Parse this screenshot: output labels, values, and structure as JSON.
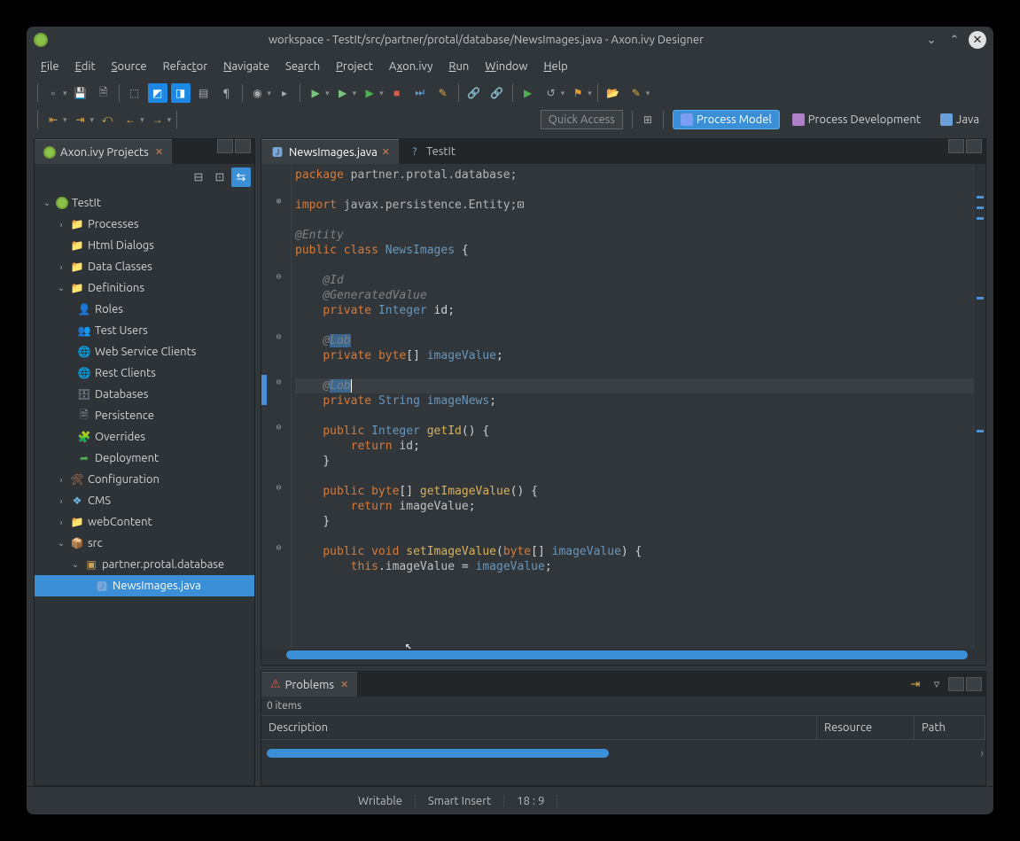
{
  "titlebar": {
    "title": "workspace - TestIt/src/partner/protal/database/NewsImages.java - Axon.ivy Designer"
  },
  "menu": [
    "File",
    "Edit",
    "Source",
    "Refactor",
    "Navigate",
    "Search",
    "Project",
    "Axon.ivy",
    "Run",
    "Window",
    "Help"
  ],
  "quick_access": "Quick Access",
  "perspectives": {
    "process_model": "Process Model",
    "process_dev": "Process Development",
    "java": "Java"
  },
  "left_view": {
    "title": "Axon.ivy Projects"
  },
  "tree": {
    "root": "TestIt",
    "items": [
      "Processes",
      "Html Dialogs",
      "Data Classes",
      "Definitions",
      "Roles",
      "Test Users",
      "Web Service Clients",
      "Rest Clients",
      "Databases",
      "Persistence",
      "Overrides",
      "Deployment",
      "Configuration",
      "CMS",
      "webContent",
      "src",
      "partner.protal.database",
      "NewsImages.java"
    ]
  },
  "editor": {
    "tab_active": "NewsImages.java",
    "tab_other": "TestIt"
  },
  "code": {
    "l1a": "package",
    "l1b": " partner.protal.database;",
    "l3a": "import",
    "l3b": " javax.persistence.Entity;",
    "l5": "@Entity",
    "l6a": "public class ",
    "l6b": "NewsImages",
    "l6c": " {",
    "l8": "@Id",
    "l9": "@GeneratedValue",
    "l10a": "private ",
    "l10b": "Integer",
    "l10c": " id;",
    "l12a": "@",
    "l12b": "Lob",
    "l13a": "private ",
    "l13b": "byte",
    "l13c": "[] ",
    "l13d": "imageValue",
    "l13e": ";",
    "l15a": "@",
    "l15b": "Lob",
    "l16a": "private ",
    "l16b": "String",
    "l16c": " ",
    "l16d": "imageNews",
    "l16e": ";",
    "l18a": "public ",
    "l18b": "Integer",
    "l18c": " ",
    "l18d": "getId",
    "l18e": "() {",
    "l19a": "return ",
    "l19b": "id",
    "l19c": ";",
    "l20": "}",
    "l22a": "public ",
    "l22b": "byte",
    "l22c": "[] ",
    "l22d": "getImageValue",
    "l22e": "() {",
    "l23a": "return ",
    "l23b": "imageValue",
    "l23c": ";",
    "l24": "}",
    "l26a": "public ",
    "l26b": "void",
    "l26c": " ",
    "l26d": "setImageValue",
    "l26e": "(",
    "l26f": "byte",
    "l26g": "[] ",
    "l26h": "imageValue",
    "l26i": ") {",
    "l27a": "this",
    "l27b": ".",
    "l27c": "imageValue",
    "l27d": " = ",
    "l27e": "imageValue",
    "l27f": ";"
  },
  "problems": {
    "title": "Problems",
    "count": "0 items",
    "h_desc": "Description",
    "h_res": "Resource",
    "h_path": "Path"
  },
  "status": {
    "writable": "Writable",
    "insert": "Smart Insert",
    "pos": "18 : 9"
  }
}
